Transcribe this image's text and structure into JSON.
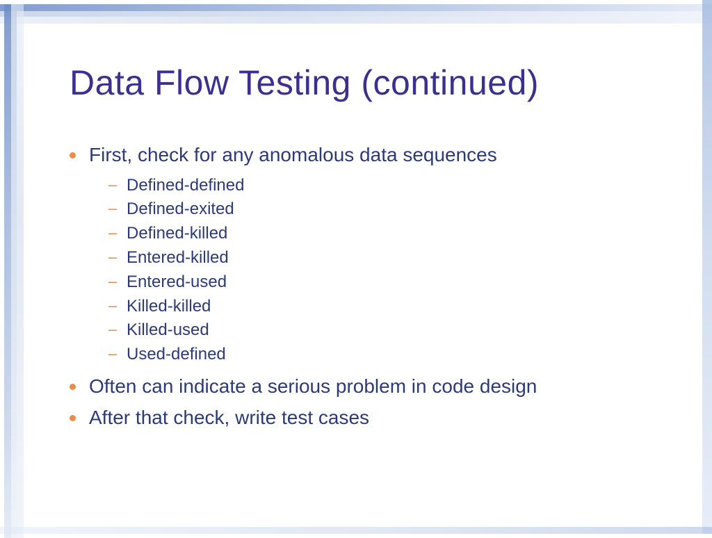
{
  "title": "Data Flow Testing (continued)",
  "bullets": [
    {
      "text": "First, check for any anomalous data sequences",
      "sub": [
        "Defined-defined",
        "Defined-exited",
        "Defined-killed",
        "Entered-killed",
        "Entered-used",
        "Killed-killed",
        "Killed-used",
        "Used-defined"
      ]
    },
    {
      "text": "Often can indicate a serious problem in code design"
    },
    {
      "text": "After that check, write test cases"
    }
  ]
}
